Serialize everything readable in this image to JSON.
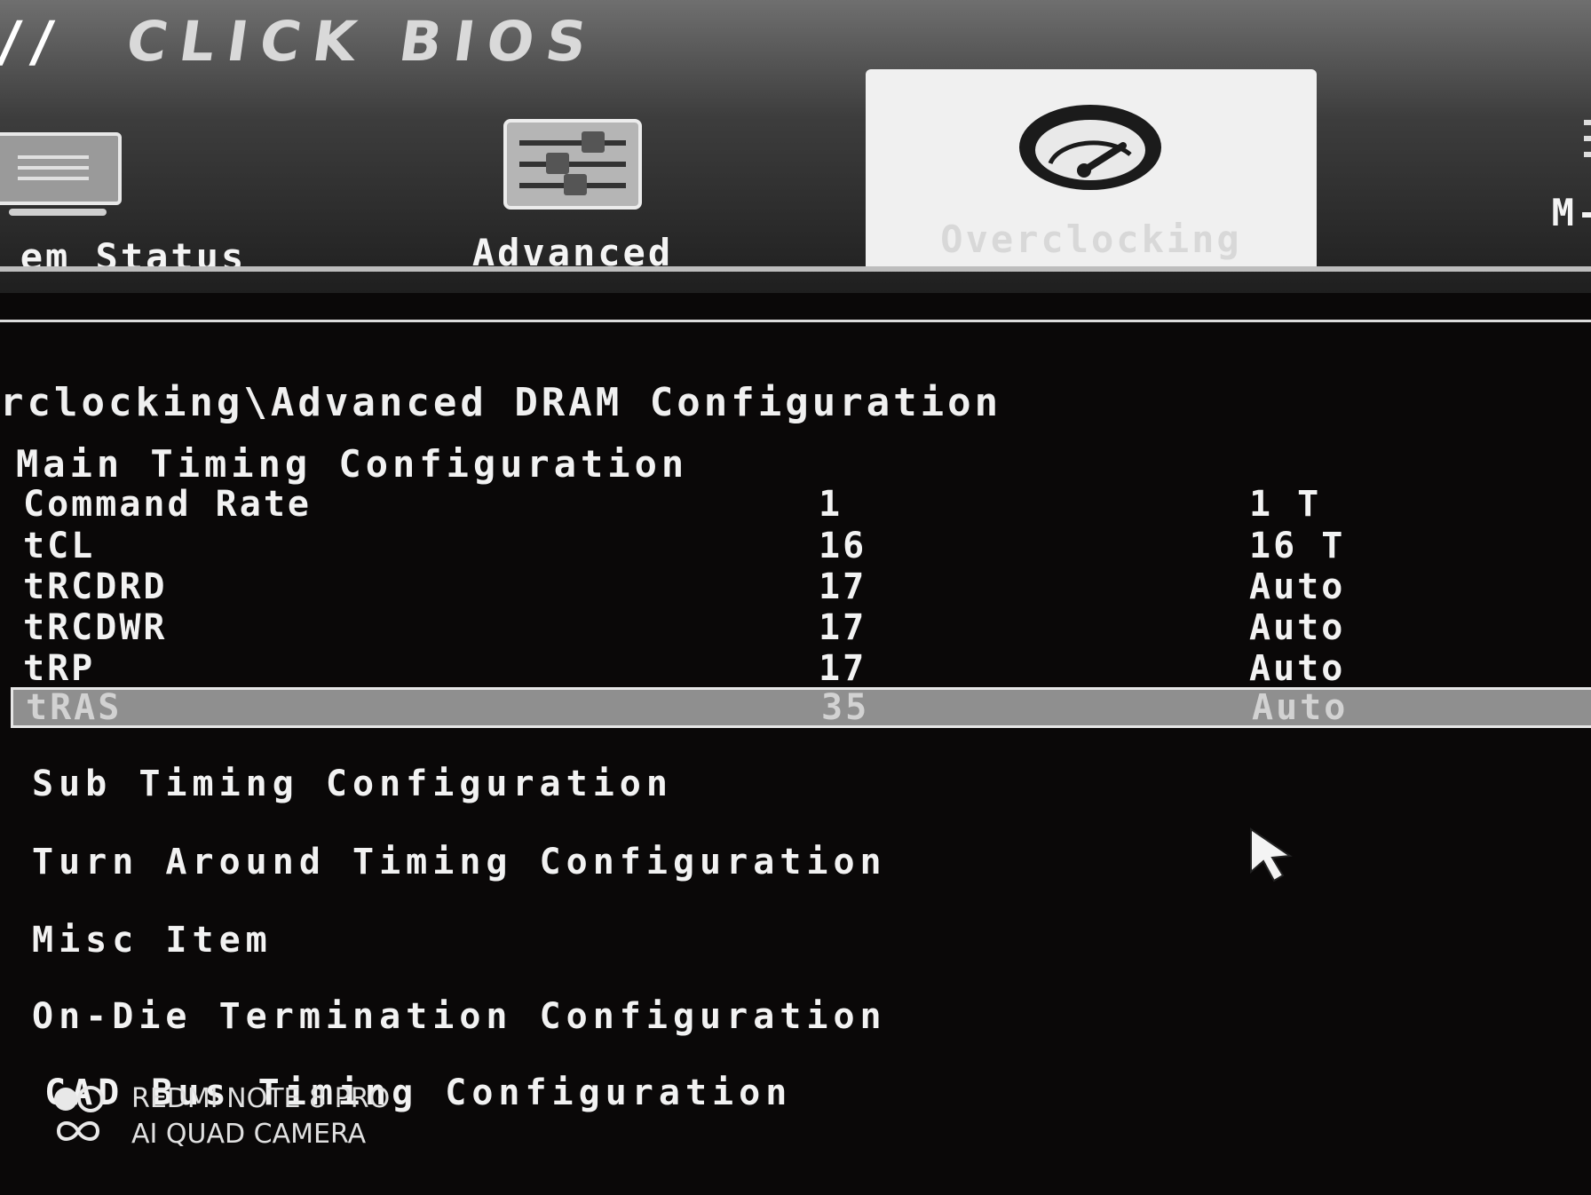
{
  "header": {
    "brand": "CLICK BIOS",
    "tabs": [
      {
        "label": "em Status",
        "icon": "monitor-icon"
      },
      {
        "label": "Advanced",
        "icon": "sliders-icon"
      },
      {
        "label": "Overclocking",
        "icon": "speedometer-icon",
        "active": true
      },
      {
        "label": "M-F",
        "icon": "chip-icon"
      }
    ]
  },
  "breadcrumb": "rclocking\\Advanced DRAM Configuration",
  "main_timing": {
    "title": "Main Timing Configuration",
    "rows": [
      {
        "name": "Command Rate",
        "current": "1",
        "setting": "1 T"
      },
      {
        "name": "tCL",
        "current": "16",
        "setting": "16 T"
      },
      {
        "name": "tRCDRD",
        "current": "17",
        "setting": "Auto"
      },
      {
        "name": "tRCDWR",
        "current": "17",
        "setting": "Auto"
      },
      {
        "name": "tRP",
        "current": "17",
        "setting": "Auto"
      },
      {
        "name": "tRAS",
        "current": "35",
        "setting": "Auto",
        "selected": true
      }
    ]
  },
  "submenus": [
    "Sub Timing Configuration",
    "Turn Around Timing Configuration",
    "Misc Item",
    "On-Die Termination Configuration",
    "CAD Bus Timing Configuration"
  ],
  "watermark": {
    "line1": "REDMI NOTE 8 PRO",
    "line2": "AI QUAD CAMERA"
  },
  "colors": {
    "background": "#0a0808",
    "text": "#f2f2f2",
    "selected_row": "#8f8f8f",
    "active_tab": "#f0f0f0"
  }
}
